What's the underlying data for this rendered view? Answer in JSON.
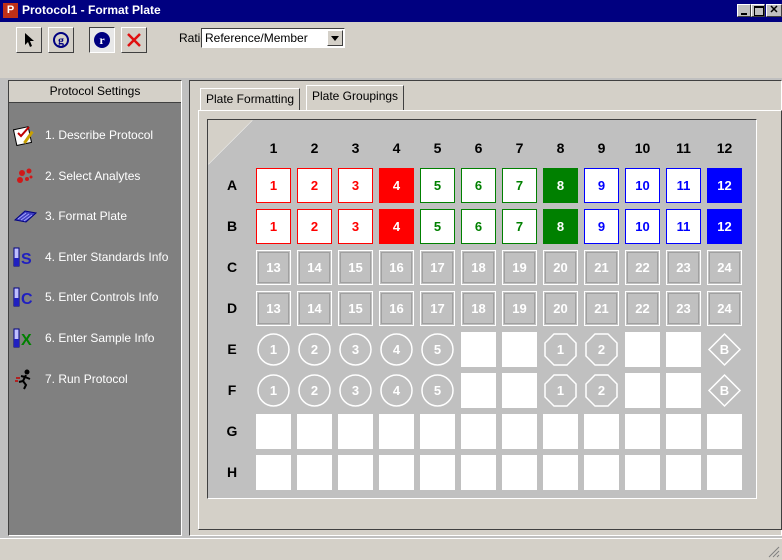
{
  "window": {
    "icon_letter": "P",
    "title": "Protocol1 - Format Plate",
    "buttons": [
      "minimize",
      "maximize",
      "close"
    ]
  },
  "toolbar": {
    "tools": [
      {
        "name": "pointer-tool",
        "icon": "arrow-pointer-icon"
      },
      {
        "name": "g-tool",
        "label": "g",
        "icon": "circle-g-icon"
      },
      {
        "name": "r-tool",
        "label": "r",
        "icon": "circle-r-icon",
        "pressed": true
      },
      {
        "name": "delete-tool",
        "icon": "red-x-icon"
      }
    ],
    "ratio_label": "Ratio:",
    "ratio_value": "Reference/Member"
  },
  "sidebar": {
    "header": "Protocol Settings",
    "items": [
      {
        "label": "1. Describe Protocol",
        "icon": "checklist-icon"
      },
      {
        "label": "2. Select Analytes",
        "icon": "molecules-icon"
      },
      {
        "label": "3. Format Plate",
        "icon": "plate-icon"
      },
      {
        "label": "4. Enter Standards Info",
        "icon": "standards-icon",
        "letter": "S"
      },
      {
        "label": "5. Enter Controls Info",
        "icon": "controls-icon",
        "letter": "C"
      },
      {
        "label": "6. Enter Sample Info",
        "icon": "samples-icon",
        "letter": "X"
      },
      {
        "label": "7. Run Protocol",
        "icon": "running-man-icon"
      }
    ]
  },
  "tabs": [
    {
      "label": "Plate Formatting",
      "active": false
    },
    {
      "label": "Plate Groupings",
      "active": true
    }
  ],
  "plate": {
    "columns": [
      "1",
      "2",
      "3",
      "4",
      "5",
      "6",
      "7",
      "8",
      "9",
      "10",
      "11",
      "12"
    ],
    "rows": [
      "A",
      "B",
      "C",
      "D",
      "E",
      "F",
      "G",
      "H"
    ],
    "colors": {
      "red": "#ff0000",
      "green": "#008000",
      "blue": "#0000ff",
      "white": "#ffffff",
      "well_bg": "#ffffff"
    },
    "wells": {
      "A": [
        {
          "t": "1",
          "s": "red"
        },
        {
          "t": "2",
          "s": "red"
        },
        {
          "t": "3",
          "s": "red"
        },
        {
          "t": "4",
          "s": "red",
          "f": true
        },
        {
          "t": "5",
          "s": "green"
        },
        {
          "t": "6",
          "s": "green"
        },
        {
          "t": "7",
          "s": "green"
        },
        {
          "t": "8",
          "s": "green",
          "f": true
        },
        {
          "t": "9",
          "s": "blue"
        },
        {
          "t": "10",
          "s": "blue"
        },
        {
          "t": "11",
          "s": "blue"
        },
        {
          "t": "12",
          "s": "blue",
          "f": true
        }
      ],
      "B": [
        {
          "t": "1",
          "s": "red"
        },
        {
          "t": "2",
          "s": "red"
        },
        {
          "t": "3",
          "s": "red"
        },
        {
          "t": "4",
          "s": "red",
          "f": true
        },
        {
          "t": "5",
          "s": "green"
        },
        {
          "t": "6",
          "s": "green"
        },
        {
          "t": "7",
          "s": "green"
        },
        {
          "t": "8",
          "s": "green",
          "f": true
        },
        {
          "t": "9",
          "s": "blue"
        },
        {
          "t": "10",
          "s": "blue"
        },
        {
          "t": "11",
          "s": "blue"
        },
        {
          "t": "12",
          "s": "blue",
          "f": true
        }
      ],
      "C": [
        {
          "t": "13",
          "s": "white"
        },
        {
          "t": "14",
          "s": "white"
        },
        {
          "t": "15",
          "s": "white"
        },
        {
          "t": "16",
          "s": "white"
        },
        {
          "t": "17",
          "s": "white"
        },
        {
          "t": "18",
          "s": "white"
        },
        {
          "t": "19",
          "s": "white"
        },
        {
          "t": "20",
          "s": "white"
        },
        {
          "t": "21",
          "s": "white"
        },
        {
          "t": "22",
          "s": "white"
        },
        {
          "t": "23",
          "s": "white"
        },
        {
          "t": "24",
          "s": "white"
        }
      ],
      "D": [
        {
          "t": "13",
          "s": "white"
        },
        {
          "t": "14",
          "s": "white"
        },
        {
          "t": "15",
          "s": "white"
        },
        {
          "t": "16",
          "s": "white"
        },
        {
          "t": "17",
          "s": "white"
        },
        {
          "t": "18",
          "s": "white"
        },
        {
          "t": "19",
          "s": "white"
        },
        {
          "t": "20",
          "s": "white"
        },
        {
          "t": "21",
          "s": "white"
        },
        {
          "t": "22",
          "s": "white"
        },
        {
          "t": "23",
          "s": "white"
        },
        {
          "t": "24",
          "s": "white"
        }
      ],
      "E": [
        {
          "t": "1",
          "shape": "circle"
        },
        {
          "t": "2",
          "shape": "circle"
        },
        {
          "t": "3",
          "shape": "circle"
        },
        {
          "t": "4",
          "shape": "circle"
        },
        {
          "t": "5",
          "shape": "circle"
        },
        {
          "t": "",
          "shape": "empty"
        },
        {
          "t": "",
          "shape": "empty"
        },
        {
          "t": "1",
          "shape": "octagon"
        },
        {
          "t": "2",
          "shape": "octagon"
        },
        {
          "t": "",
          "shape": "empty"
        },
        {
          "t": "",
          "shape": "empty"
        },
        {
          "t": "B",
          "shape": "diamond"
        }
      ],
      "F": [
        {
          "t": "1",
          "shape": "circle"
        },
        {
          "t": "2",
          "shape": "circle"
        },
        {
          "t": "3",
          "shape": "circle"
        },
        {
          "t": "4",
          "shape": "circle"
        },
        {
          "t": "5",
          "shape": "circle"
        },
        {
          "t": "",
          "shape": "empty"
        },
        {
          "t": "",
          "shape": "empty"
        },
        {
          "t": "1",
          "shape": "octagon"
        },
        {
          "t": "2",
          "shape": "octagon"
        },
        {
          "t": "",
          "shape": "empty"
        },
        {
          "t": "",
          "shape": "empty"
        },
        {
          "t": "B",
          "shape": "diamond"
        }
      ],
      "G": [
        {
          "t": "",
          "shape": "empty"
        },
        {
          "t": "",
          "shape": "empty"
        },
        {
          "t": "",
          "shape": "empty"
        },
        {
          "t": "",
          "shape": "empty"
        },
        {
          "t": "",
          "shape": "empty"
        },
        {
          "t": "",
          "shape": "empty"
        },
        {
          "t": "",
          "shape": "empty"
        },
        {
          "t": "",
          "shape": "empty"
        },
        {
          "t": "",
          "shape": "empty"
        },
        {
          "t": "",
          "shape": "empty"
        },
        {
          "t": "",
          "shape": "empty"
        },
        {
          "t": "",
          "shape": "empty"
        }
      ],
      "H": [
        {
          "t": "",
          "shape": "empty"
        },
        {
          "t": "",
          "shape": "empty"
        },
        {
          "t": "",
          "shape": "empty"
        },
        {
          "t": "",
          "shape": "empty"
        },
        {
          "t": "",
          "shape": "empty"
        },
        {
          "t": "",
          "shape": "empty"
        },
        {
          "t": "",
          "shape": "empty"
        },
        {
          "t": "",
          "shape": "empty"
        },
        {
          "t": "",
          "shape": "empty"
        },
        {
          "t": "",
          "shape": "empty"
        },
        {
          "t": "",
          "shape": "empty"
        },
        {
          "t": "",
          "shape": "empty"
        }
      ]
    }
  }
}
